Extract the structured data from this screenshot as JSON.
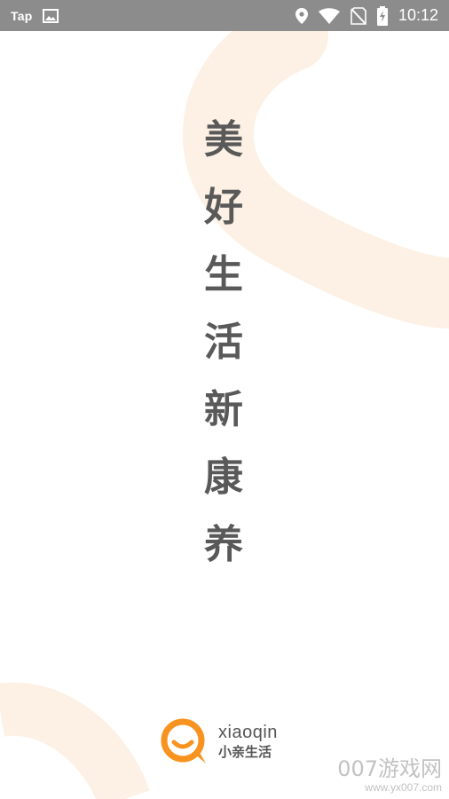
{
  "status_bar": {
    "left_text": "Tap",
    "time": "10:12",
    "icons": [
      "image-icon",
      "location-icon",
      "wifi-icon",
      "no-sim-icon",
      "battery-charging-icon"
    ]
  },
  "slogan": {
    "chars": [
      "美",
      "好",
      "生",
      "活",
      "新",
      "康",
      "养"
    ]
  },
  "brand": {
    "name_en": "xiaoqin",
    "name_cn": "小亲生活",
    "logo_icon": "q-speech-bubble-icon",
    "accent_color": "#F7931E"
  },
  "watermark": {
    "text": "007游戏网",
    "url": "www.yx007.com"
  }
}
